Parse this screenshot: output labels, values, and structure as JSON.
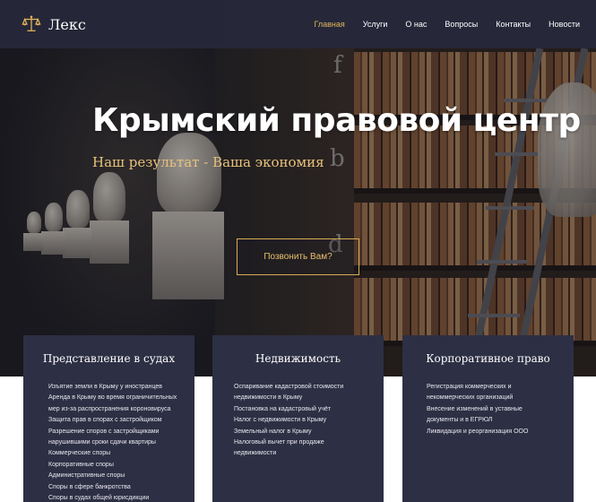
{
  "header": {
    "logo_text": "Лекс",
    "nav": [
      "Главная",
      "Услуги",
      "О нас",
      "Вопросы",
      "Контакты",
      "Новости"
    ]
  },
  "hero": {
    "title": "Крымский правовой центр",
    "subtitle": "Наш результат - Ваша экономия",
    "cta_label": "Позвонить Вам?",
    "background_letters": [
      "f",
      "b",
      "d"
    ]
  },
  "cards": [
    {
      "title": "Представление в судах",
      "items": [
        "Изъятие земли в Крыму у иностранцев",
        "Аренда в Крыму во время ограничительных",
        "мер из-за распространения короновируса",
        "Защита прав в спорах с застройщиком",
        "Разрешение споров с застройщиками",
        "нарушившими сроки сдачи квартиры",
        "Коммерческие споры",
        "Корпоративные споры",
        "Административные споры",
        "Споры в сфере банкротства",
        "Споры в судах общей юрисдикции"
      ]
    },
    {
      "title": "Недвижимость",
      "items": [
        "Оспаривание кадастровой стоимости",
        "недвижимости в Крыму",
        "Постановка на кадастровый учёт",
        "Налог с недвижимости в Крыму",
        "Земельный налог в Крыму",
        "Налоговый вычет при продаже",
        "недвижимости"
      ]
    },
    {
      "title": "Корпоративное право",
      "items": [
        "Регистрация коммерческих и",
        "некоммерческих организаций",
        "Внесение изменений в уставные",
        "документы и в ЕГРЮЛ",
        "Ликвидация и реорганизация ООО"
      ]
    }
  ],
  "colors": {
    "navbar": "#26283a",
    "accent": "#e2b45a",
    "card": "#2d2f44"
  },
  "icons": {
    "logo": "scales-of-justice-icon"
  }
}
